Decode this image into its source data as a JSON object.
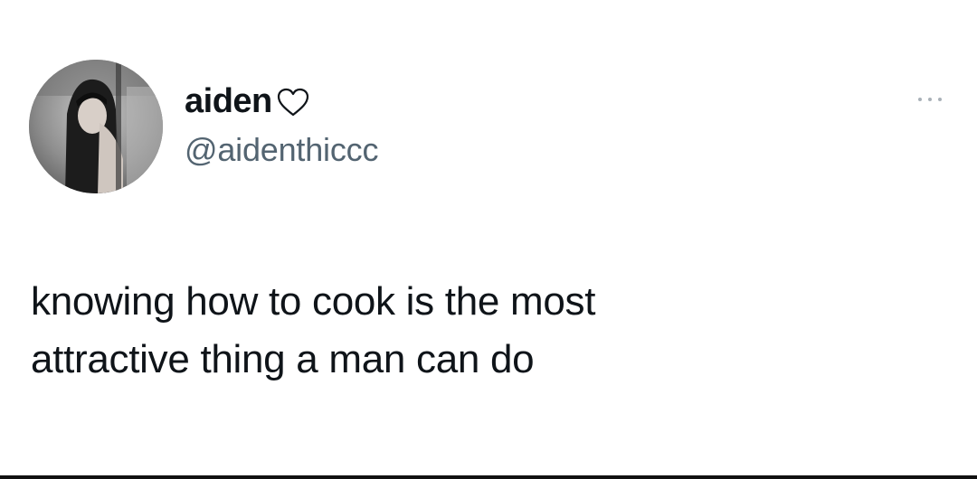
{
  "author": {
    "display_name": "aiden",
    "handle": "@aidenthiccc",
    "name_icon": "heart-outline-icon",
    "avatar_icon": "profile-photo"
  },
  "menu": {
    "icon": "more-options-icon"
  },
  "tweet": {
    "line1": "knowing how to cook is the most",
    "line2": "attractive thing a man can do"
  },
  "colors": {
    "text": "#0f1419",
    "secondary_text": "#536471",
    "background": "#ffffff",
    "divider": "#111111"
  }
}
